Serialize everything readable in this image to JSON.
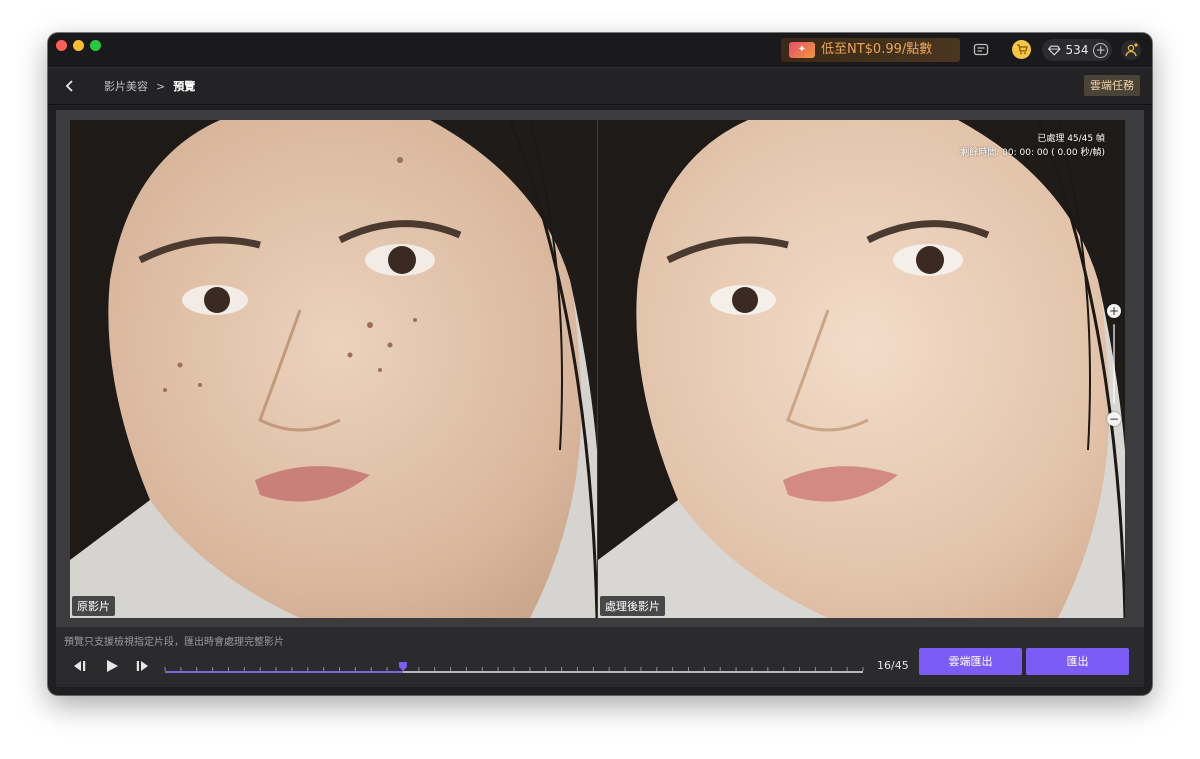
{
  "promo": {
    "text": "低至NT$0.99/點數"
  },
  "credits": {
    "count": "534"
  },
  "nav": {
    "breadcrumb_parent": "影片美容",
    "breadcrumb_separator": ">",
    "breadcrumb_current": "預覽",
    "cloud_task_label": "雲端任務"
  },
  "preview": {
    "original_label": "原影片",
    "processed_label": "處理後影片",
    "processed_frames": "已處理 45/45 幀",
    "remaining_time": "剩餘時間: 00: 00: 00 ( 0.00 秒/幀)",
    "zoom_in_symbol": "+",
    "zoom_out_symbol": "−"
  },
  "footer": {
    "notice": "預覽只支援檢視指定片段，匯出時會處理完整影片",
    "frame_counter": "16/45",
    "cloud_export_label": "雲端匯出",
    "export_label": "匯出",
    "current_frame": 16,
    "total_frames": 45
  },
  "colors": {
    "accent": "#7b5cf5",
    "promo_text": "#e7a75a",
    "window_bg": "#1f1f21"
  },
  "icons": {
    "back": "chevron-left-icon",
    "chat": "chat-icon",
    "shop": "shopping-cart-icon",
    "diamond": "diamond-icon",
    "add": "plus-circle-icon",
    "user": "user-avatar-icon",
    "prev": "step-backward-icon",
    "play": "play-icon",
    "next": "step-forward-icon"
  }
}
